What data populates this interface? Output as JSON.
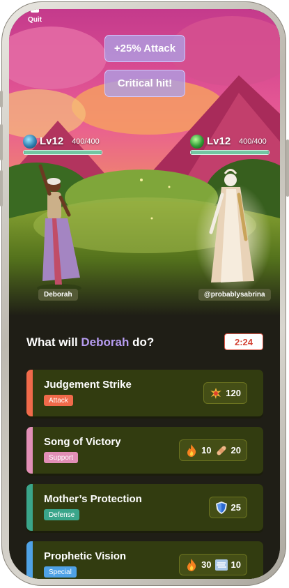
{
  "quit_label": "Quit",
  "buffs": [
    "+25% Attack",
    "Critical hit!"
  ],
  "player": {
    "name": "Deborah",
    "level": "Lv12",
    "hp": "400/400",
    "hp_fraction": 1.0
  },
  "opponent": {
    "name": "@probablysabrina",
    "level": "Lv12",
    "hp": "400/400",
    "hp_fraction": 1.0
  },
  "prompt": {
    "before": "What will ",
    "hero": "Deborah",
    "after": " do?"
  },
  "timer": "2:24",
  "moves": [
    {
      "name": "Judgement Strike",
      "tag": "Attack",
      "color": "#f06a4a",
      "costs": [
        {
          "icon": "explosion-icon",
          "value": "120"
        }
      ]
    },
    {
      "name": "Song of Victory",
      "tag": "Support",
      "color": "#e28fb6",
      "costs": [
        {
          "icon": "fire-icon",
          "value": "10"
        },
        {
          "icon": "bandage-icon",
          "value": "20"
        }
      ]
    },
    {
      "name": "Mother’s Protection",
      "tag": "Defense",
      "color": "#3aa58a",
      "costs": [
        {
          "icon": "shield-icon",
          "value": "25"
        }
      ]
    },
    {
      "name": "Prophetic Vision",
      "tag": "Special",
      "color": "#4fa2e6",
      "costs": [
        {
          "icon": "fire-icon",
          "value": "30"
        },
        {
          "icon": "fog-icon",
          "value": "10"
        }
      ]
    }
  ]
}
